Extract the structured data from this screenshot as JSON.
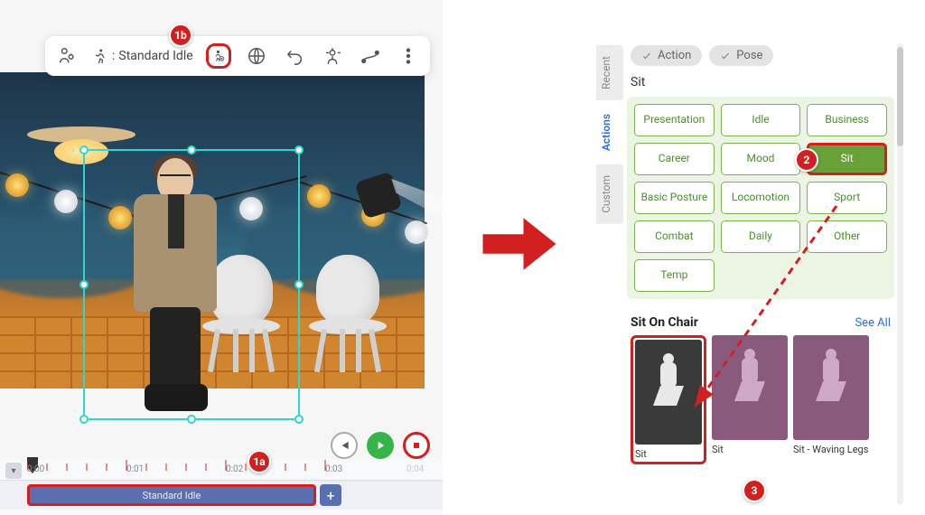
{
  "toolbar": {
    "current_action_prefix": ": ",
    "current_action": "Standard Idle"
  },
  "timeline": {
    "clip_name": "Standard Idle",
    "ticks": [
      "0:00",
      "0:01",
      "0:02",
      "0:03",
      "0:04"
    ],
    "add_label": "+"
  },
  "panel": {
    "pills": {
      "action": "Action",
      "pose": "Pose"
    },
    "search_value": "Sit",
    "tabs": {
      "recent": "Recent",
      "actions": "Actions",
      "custom": "Custom"
    },
    "categories": [
      "Presentation",
      "Idle",
      "Business",
      "Career",
      "Mood",
      "Sit",
      "Basic Posture",
      "Locomotion",
      "Sport",
      "Combat",
      "Daily",
      "Other",
      "Temp"
    ],
    "section_title": "Sit On Chair",
    "see_all": "See All",
    "thumbs": [
      {
        "label": "Sit"
      },
      {
        "label": "Sit"
      },
      {
        "label": "Sit - Waving Legs"
      }
    ]
  },
  "annotations": {
    "b1a": "1a",
    "b1b": "1b",
    "b2": "2",
    "b3": "3"
  }
}
